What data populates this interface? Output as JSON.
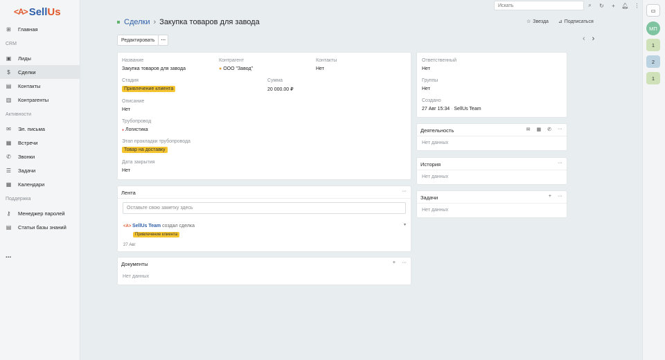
{
  "app": {
    "logo_mark": "<A>",
    "logo_name_a": "Sell",
    "logo_name_b": "Us"
  },
  "sidebar": {
    "items": [
      {
        "label": "Главная",
        "icon": "grid-icon",
        "glyph": "⊞"
      },
      {
        "section": "CRM"
      },
      {
        "label": "Лиды",
        "icon": "leads-icon",
        "glyph": "▣"
      },
      {
        "label": "Сделки",
        "icon": "dollar-icon",
        "glyph": "$",
        "active": true
      },
      {
        "label": "Контакты",
        "icon": "contacts-icon",
        "glyph": "▤"
      },
      {
        "label": "Контрагенты",
        "icon": "company-icon",
        "glyph": "▥"
      },
      {
        "section": "Активности"
      },
      {
        "label": "Эл. письма",
        "icon": "mail-icon",
        "glyph": "✉"
      },
      {
        "label": "Встречи",
        "icon": "calendar-icon",
        "glyph": "▦"
      },
      {
        "label": "Звонки",
        "icon": "phone-icon",
        "glyph": "✆"
      },
      {
        "label": "Задачи",
        "icon": "tasks-icon",
        "glyph": "☰"
      },
      {
        "label": "Календари",
        "icon": "calendar-icon",
        "glyph": "▦"
      },
      {
        "section": "Поддержка"
      },
      {
        "label": "Менеджер паролей",
        "icon": "key-icon",
        "glyph": "⚷"
      },
      {
        "label": "Статьи базы знаний",
        "icon": "book-icon",
        "glyph": "▤"
      }
    ],
    "more": "..."
  },
  "topbar": {
    "search_placeholder": "Искать"
  },
  "rail": {
    "avatar": "МП",
    "badges": [
      "1",
      "2",
      "1"
    ]
  },
  "header": {
    "breadcrumb": "Сделки",
    "title": "Закупка товаров для завода",
    "star": "Звезда",
    "subscribe": "Подписаться",
    "edit": "Редактировать",
    "more": "···"
  },
  "details": {
    "name_label": "Название",
    "name": "Закупка товаров для завода",
    "counterparty_label": "Контрагент",
    "counterparty": "ООО \"Завод\"",
    "contacts_label": "Контакты",
    "contacts": "Нет",
    "stage_label": "Стадия",
    "stage": "Привлечение клиента",
    "amount_label": "Сумма",
    "amount": "20 000.00 ₽",
    "description_label": "Описание",
    "description": "Нет",
    "pipeline_label": "Трубопровод",
    "pipeline": "Логистика",
    "pipeline_stage_label": "Этап прокладки трубопровода",
    "pipeline_stage": "Товар на доставку",
    "close_date_label": "Дата закрытия",
    "close_date": "Нет"
  },
  "side": {
    "responsible_label": "Ответственный",
    "responsible": "Нет",
    "groups_label": "Группы",
    "groups": "Нет",
    "created_label": "Создано",
    "created_at": "27 Авг 15:34",
    "created_dot": "·",
    "created_by": "SellUs Team"
  },
  "feed": {
    "title": "Лента",
    "placeholder": "Оставьте свою заметку здесь",
    "author": "SellUs Team",
    "action": "создал сделка",
    "badge": "Привлечение клиента",
    "date": "27 Авг"
  },
  "documents": {
    "title": "Документы",
    "empty": "Нет данных"
  },
  "activity": {
    "title": "Деятельность",
    "empty": "Нет данных"
  },
  "history": {
    "title": "История",
    "empty": "Нет данных"
  },
  "tasks": {
    "title": "Задачи",
    "empty": "Нет данных"
  },
  "colors": {
    "accent": "#2f5fa8",
    "brand": "#e0582b",
    "badge": "#f5c431"
  }
}
